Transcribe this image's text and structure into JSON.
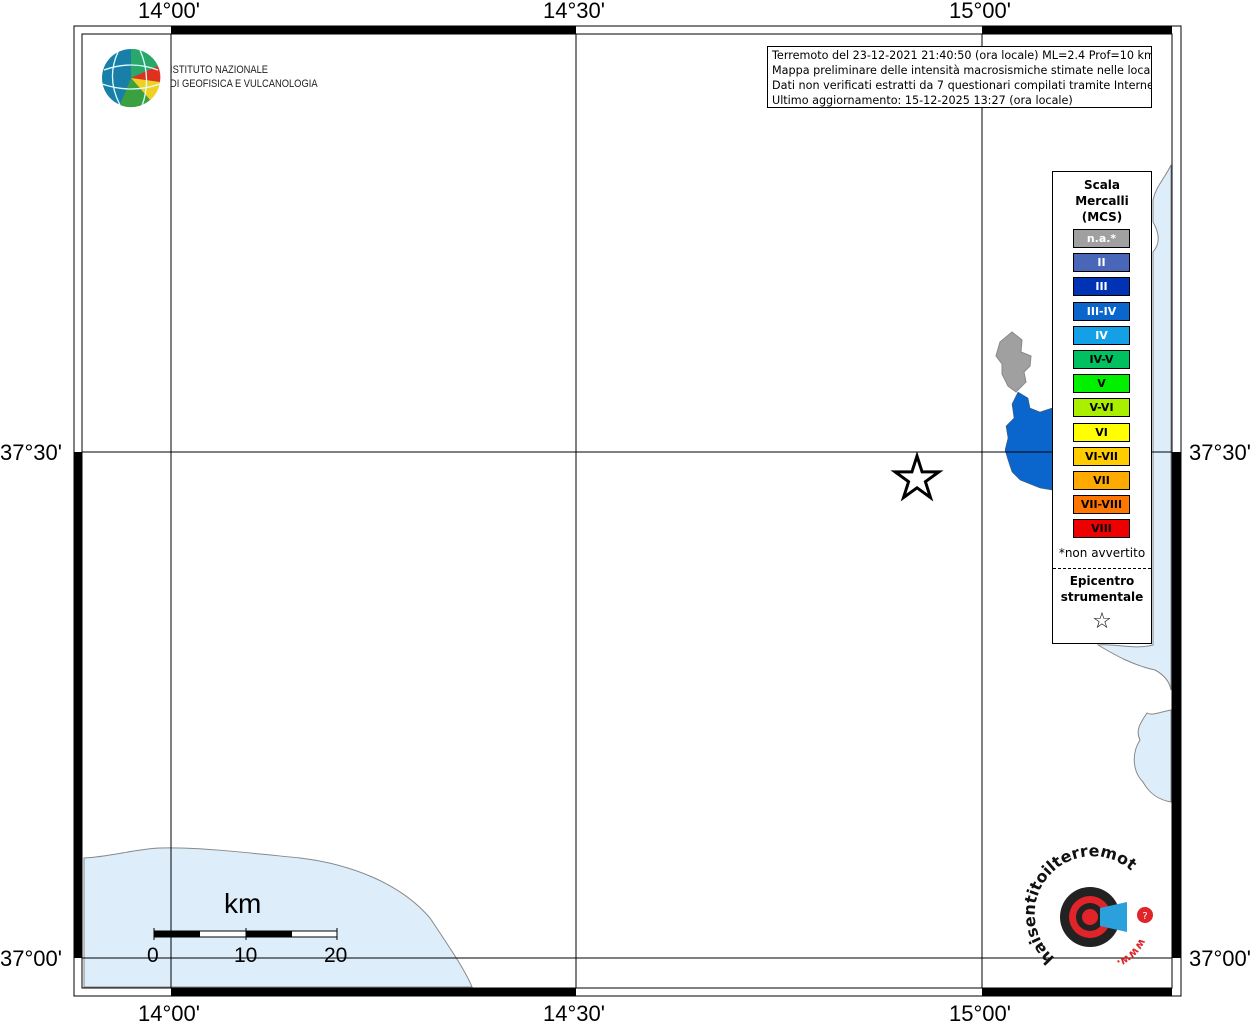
{
  "map": {
    "coords": {
      "lon_top": [
        "14°00'",
        "14°30'",
        "15°00'"
      ],
      "lon_bottom": [
        "14°00'",
        "14°30'",
        "15°00'"
      ],
      "lat_left": [
        "37°30'",
        "37°00'"
      ],
      "lat_right": [
        "37°30'",
        "37°00'"
      ]
    },
    "info": {
      "line1": "Terremoto del 23-12-2021 21:40:50 (ora locale) ML=2.4 Prof=10 km",
      "line2": "Mappa preliminare delle intensità macrosismiche stimate nelle località",
      "line3": "Dati non verificati estratti da 7 questionari compilati tramite Internet.",
      "line4": "Ultimo aggiornamento: 15-12-2025 13:27 (ora locale)"
    },
    "logo": {
      "line1": "ISTITUTO NAZIONALE",
      "line2": "DI GEOFISICA E VULCANOLOGIA"
    },
    "legend": {
      "title_line1": "Scala",
      "title_line2": "Mercalli",
      "title_line3": "(MCS)",
      "items": [
        {
          "label": "n.a.*",
          "color": "#a0a0a0"
        },
        {
          "label": "II",
          "color": "#4a66b8"
        },
        {
          "label": "III",
          "color": "#0033b3"
        },
        {
          "label": "III-IV",
          "color": "#0a66cc"
        },
        {
          "label": "IV",
          "color": "#14a0e6"
        },
        {
          "label": "IV-V",
          "color": "#00c060"
        },
        {
          "label": "V",
          "color": "#00f000"
        },
        {
          "label": "V-VI",
          "color": "#aaee00"
        },
        {
          "label": "VI",
          "color": "#ffff00"
        },
        {
          "label": "VI-VII",
          "color": "#ffcc00"
        },
        {
          "label": "VII",
          "color": "#ffaa00"
        },
        {
          "label": "VII-VIII",
          "color": "#ff7700"
        },
        {
          "label": "VIII",
          "color": "#ee0000"
        }
      ],
      "note": "*non avvertito",
      "epicenter_line1": "Epicentro",
      "epicenter_line2": "strumentale",
      "star": "☆"
    },
    "scale_bar": {
      "unit": "km",
      "labels": [
        "0",
        "10",
        "20"
      ]
    },
    "badge": {
      "text": "haisentitoilterremoto.it",
      "prefix": "www."
    },
    "colors": {
      "sea": "#ddeefa",
      "felt_blue": "#0a66cc",
      "na_grey": "#a0a0a0"
    }
  }
}
